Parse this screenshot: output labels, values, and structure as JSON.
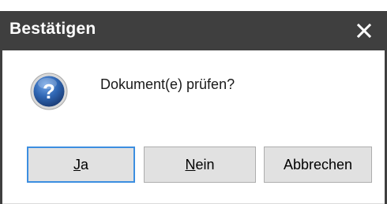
{
  "dialog": {
    "title": "Bestätigen",
    "message": "Dokument(e) prüfen?",
    "icon": "question-icon",
    "close_icon": "close-icon"
  },
  "buttons": {
    "yes": {
      "mnemonic": "J",
      "rest": "a"
    },
    "no": {
      "mnemonic": "N",
      "rest": "ein"
    },
    "cancel": {
      "label": "Abbrechen"
    }
  },
  "colors": {
    "titlebar": "#3f3f3f",
    "title_text": "#ffffff",
    "focus_border": "#3c8ee0",
    "button_face": "#e1e1e1",
    "icon_blue": "#2f66b3"
  }
}
